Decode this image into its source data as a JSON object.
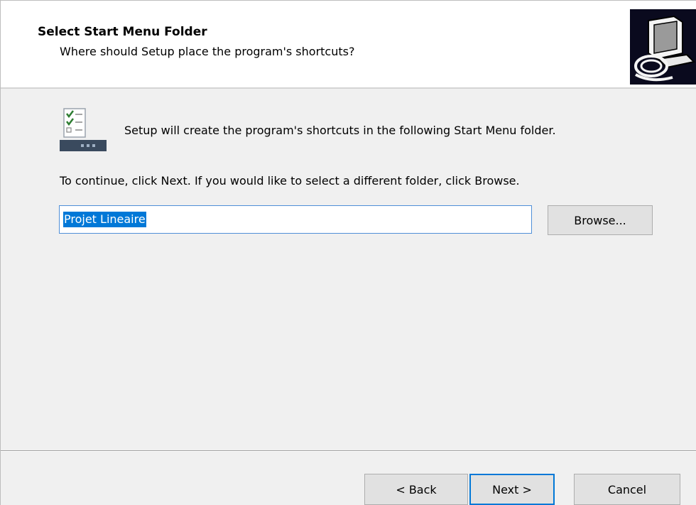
{
  "header": {
    "title": "Select Start Menu Folder",
    "subtitle": "Where should Setup place the program's shortcuts?",
    "logo_icon": "setup-computer-icon"
  },
  "content": {
    "icon": "start-menu-checklist-icon",
    "intro_text": "Setup will create the program's shortcuts in the following Start Menu folder.",
    "instruction_text": "To continue, click Next. If you would like to select a different folder, click Browse.",
    "folder_value": "Projet Lineaire",
    "browse_label": "Browse..."
  },
  "footer": {
    "back_label": "< Back",
    "next_label": "Next >",
    "cancel_label": "Cancel"
  },
  "colors": {
    "selection": "#0078d7",
    "button_face": "#e1e1e1",
    "header_bg": "#ffffff",
    "body_bg": "#f0f0f0"
  }
}
